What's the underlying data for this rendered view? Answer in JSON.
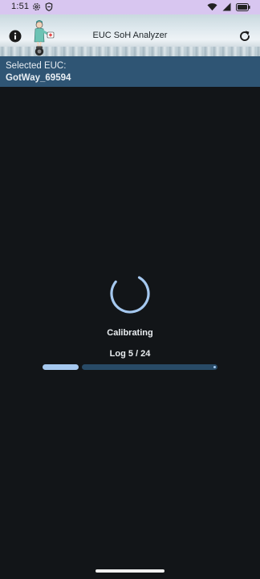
{
  "status_bar": {
    "time": "1:51",
    "left_icons": [
      "settings-gear-icon",
      "shield-icon"
    ],
    "right_icons": [
      "wifi-icon",
      "signal-icon",
      "battery-icon"
    ],
    "background": "#d8c6f0"
  },
  "app_bar": {
    "title": "EUC SoH Analyzer",
    "info_icon": "info-icon",
    "refresh_icon": "refresh-icon",
    "mascot": "nurse-on-unicycle-mascot"
  },
  "selected": {
    "label": "Selected EUC:",
    "value": "GotWay_69594",
    "background": "#2f5574"
  },
  "progress": {
    "status": "Calibrating",
    "log_text": "Log 5 / 24",
    "current": 5,
    "total": 24,
    "fraction": 0.2083,
    "fill_color": "#a5c8ef",
    "track_color": "#284a66"
  },
  "colors": {
    "background": "#121518",
    "accent": "#a5c8ef"
  }
}
